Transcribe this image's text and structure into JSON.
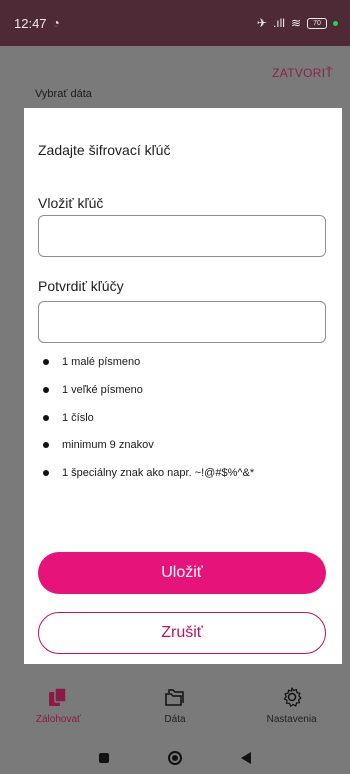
{
  "status_bar": {
    "time": "12:47",
    "battery": "70"
  },
  "background": {
    "close_label": "ZATVORIŤ",
    "page_label": "Vybrať dáta"
  },
  "dialog": {
    "title": "Zadajte šifrovací kľúč",
    "key_label": "Vložiť kľúč",
    "key_value": "",
    "confirm_label": "Potvrdiť kľúčy",
    "confirm_value": "",
    "requirements": [
      "1 malé písmeno",
      "1 veľké písmeno",
      "1 číslo",
      "minimum 9 znakov",
      "1 špeciálny znak ako napr. ~!@#$%^&*"
    ],
    "save_label": "Uložiť",
    "cancel_label": "Zrušiť"
  },
  "bottom_nav": {
    "items": [
      {
        "label": "Zálohovať",
        "icon": "backup-icon",
        "active": true
      },
      {
        "label": "Dáta",
        "icon": "folder-icon",
        "active": false
      },
      {
        "label": "Nastavenia",
        "icon": "gear-icon",
        "active": false
      }
    ]
  },
  "colors": {
    "accent": "#e5137a",
    "status_bar": "#4d2a36",
    "scrim": "#7a7a7a"
  }
}
